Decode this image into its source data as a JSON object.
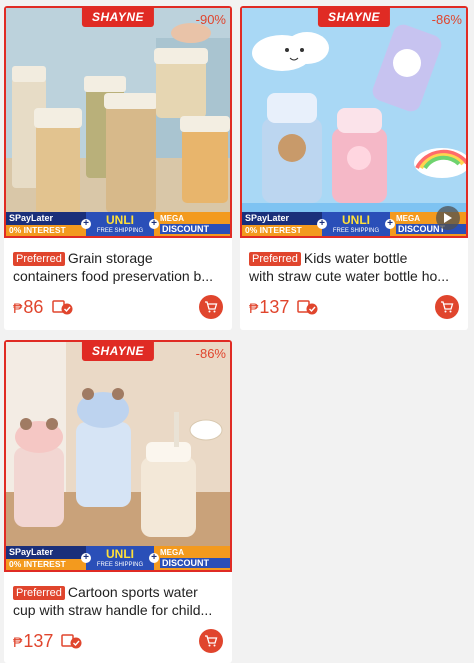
{
  "products": [
    {
      "brand": "SHAYNE",
      "discount": "-90%",
      "banner": {
        "paylater": "SPayLater",
        "interest": "0% INTEREST",
        "unli": "UNLI",
        "free_shipping": "FREE SHIPPING",
        "mega": "MEGA",
        "mega_discount": "DISCOUNT"
      },
      "preferred": "Preferred",
      "title_line1": "Grain storage",
      "title_line2": "containers food preservation b...",
      "currency": "₱",
      "price": "86",
      "has_video": false
    },
    {
      "brand": "SHAYNE",
      "discount": "-86%",
      "banner": {
        "paylater": "SPayLater",
        "interest": "0% INTEREST",
        "unli": "UNLI",
        "free_shipping": "FREE SHIPPING",
        "mega": "MEGA",
        "mega_discount": "DISCOUNT"
      },
      "preferred": "Preferred",
      "title_line1": "Kids water bottle",
      "title_line2": "with straw cute water bottle ho...",
      "currency": "₱",
      "price": "137",
      "has_video": true
    },
    {
      "brand": "SHAYNE",
      "discount": "-86%",
      "banner": {
        "paylater": "SPayLater",
        "interest": "0% INTEREST",
        "unli": "UNLI",
        "free_shipping": "FREE SHIPPING",
        "mega": "MEGA",
        "mega_discount": "DISCOUNT"
      },
      "preferred": "Preferred",
      "title_line1": "Cartoon sports water",
      "title_line2": "cup with straw handle for child...",
      "currency": "₱",
      "price": "137",
      "has_video": false
    }
  ],
  "icons": {
    "cart": "cart-icon",
    "paylater": "spaylater-badge-icon",
    "play": "play-icon"
  },
  "colors": {
    "accent": "#e0452d",
    "badge_red": "#e02b24",
    "banner_navy": "#1a2f7a",
    "banner_orange": "#f39a1e"
  }
}
